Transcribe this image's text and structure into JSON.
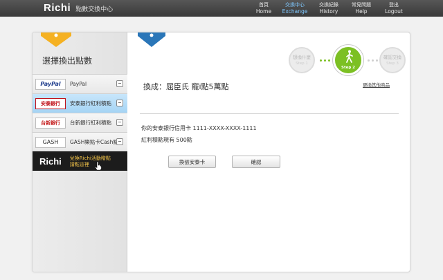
{
  "header": {
    "logo": "Richi",
    "subtitle": "點數交換中心",
    "nav": [
      {
        "zh": "首頁",
        "en": "Home",
        "active": false
      },
      {
        "zh": "交換中心",
        "en": "Exchange",
        "active": true
      },
      {
        "zh": "交換紀錄",
        "en": "History",
        "active": false
      },
      {
        "zh": "常見問題",
        "en": "Help",
        "active": false
      },
      {
        "zh": "登出",
        "en": "Logout",
        "active": false
      }
    ]
  },
  "sidebar": {
    "title": "選擇換出點數",
    "items": [
      {
        "logo": "PayPal",
        "label": "PayPal"
      },
      {
        "logo": "安泰銀行",
        "label": "安泰銀行紅利積點"
      },
      {
        "logo": "台新銀行",
        "label": "台新銀行紅利積點"
      },
      {
        "logo": "GASH",
        "label": "GASH樂點卡Cash點"
      }
    ],
    "promo": {
      "logo": "Richi",
      "line1": "兌換Richi活動贈點",
      "line2": "請點這裡"
    }
  },
  "steps": [
    {
      "label": "想換什麼",
      "no": "Step 1"
    },
    {
      "label": "",
      "no": "Step 2"
    },
    {
      "label": "確認交換",
      "no": "Step 3"
    }
  ],
  "content": {
    "title": "換成：屈臣氏 寵i點5萬點",
    "change_link": "更換其他商品",
    "card_line": "你的安泰銀行信用卡 1111-XXXX-XXXX-1111",
    "points_line": "紅利積點現有 500點",
    "btn_change_card": "換張安泰卡",
    "btn_confirm": "確認"
  },
  "colors": {
    "accent_green": "#7cc023",
    "ribbon_yellow": "#f5b122",
    "ribbon_blue": "#2a76b8",
    "selected_blue": "#a5d4f4"
  }
}
